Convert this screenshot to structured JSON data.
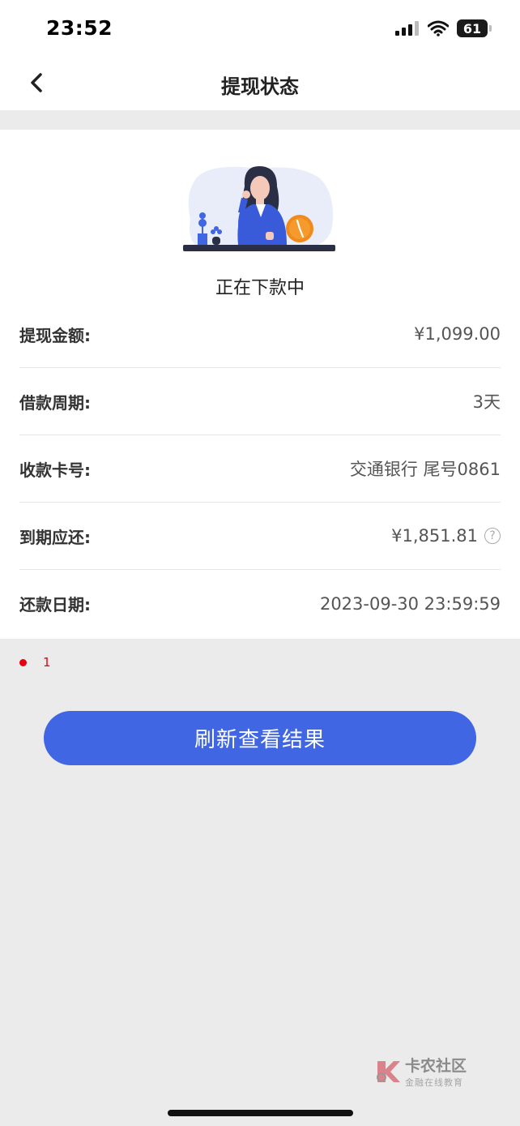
{
  "status_bar": {
    "time": "23:52",
    "battery": "61"
  },
  "nav": {
    "title": "提现状态"
  },
  "card": {
    "status_text": "正在下款中",
    "rows": [
      {
        "label": "提现金额:",
        "value": "¥1,099.00"
      },
      {
        "label": "借款周期:",
        "value": "3天"
      },
      {
        "label": "收款卡号:",
        "value": "交通银行 尾号0861"
      },
      {
        "label": "到期应还:",
        "value": "¥1,851.81",
        "help_icon": "question-circle-icon",
        "help_glyph": "?"
      },
      {
        "label": "还款日期:",
        "value": "2023-09-30 23:59:59"
      }
    ]
  },
  "note": {
    "text": "1"
  },
  "actions": {
    "refresh_label": "刷新查看结果"
  },
  "watermark": {
    "title": "卡农社区",
    "subtitle": "金融在线教育"
  },
  "colors": {
    "primary": "#4166e3",
    "note_red": "#e60012",
    "page_bg": "#ebebeb"
  }
}
